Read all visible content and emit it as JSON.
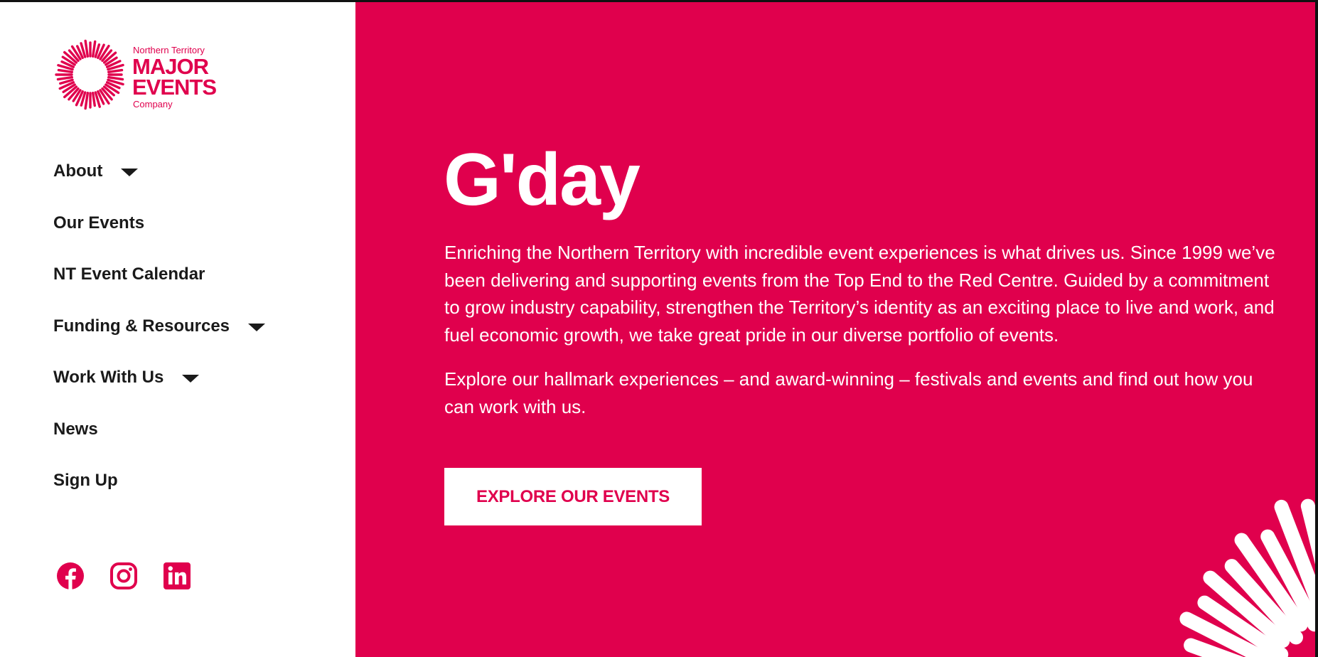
{
  "logo": {
    "line1": "Northern Territory",
    "line2": "MAJOR",
    "line3": "EVENTS",
    "line4": "Company",
    "icon": "sunburst-logo-icon"
  },
  "nav": {
    "items": [
      {
        "label": "About",
        "has_dropdown": true
      },
      {
        "label": "Our Events",
        "has_dropdown": false
      },
      {
        "label": "NT Event Calendar",
        "has_dropdown": false
      },
      {
        "label": "Funding & Resources",
        "has_dropdown": true
      },
      {
        "label": "Work With Us",
        "has_dropdown": true
      },
      {
        "label": "News",
        "has_dropdown": false
      },
      {
        "label": "Sign Up",
        "has_dropdown": false
      }
    ]
  },
  "social": [
    {
      "icon": "facebook-icon"
    },
    {
      "icon": "instagram-icon"
    },
    {
      "icon": "linkedin-icon"
    }
  ],
  "hero": {
    "title": "G'day",
    "paragraph1": "Enriching the Northern Territory with incredible event experiences is what drives us. Since 1999 we’ve been delivering and supporting events from the Top End to the Red Centre. Guided by a commitment to grow industry capability, strengthen the Territory’s identity as an exciting place to live and work, and fuel economic growth, we take great pride in our diverse portfolio of events.",
    "paragraph2": "Explore our hallmark experiences – and award-winning – festivals and events and find out how you can work with us.",
    "cta_label": "EXPLORE OUR EVENTS"
  },
  "colors": {
    "brand": "#e0004d",
    "sidebar_bg": "#ffffff",
    "nav_text": "#1a1a1a",
    "hero_text": "#ffffff"
  }
}
